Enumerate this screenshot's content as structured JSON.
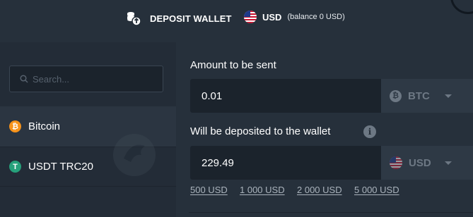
{
  "header": {
    "deposit_label": "DEPOSIT WALLET",
    "currency": "USD",
    "balance": "(balance 0 USD)"
  },
  "sidebar": {
    "search_placeholder": "Search...",
    "items": [
      {
        "label": "Bitcoin",
        "icon": "bitcoin-icon",
        "color": "#f7931a",
        "active": true
      },
      {
        "label": "USDT TRC20",
        "icon": "tether-icon",
        "color": "#26a17b",
        "active": false
      }
    ]
  },
  "form": {
    "amount_label": "Amount to be sent",
    "amount_value": "0.01",
    "amount_currency": "BTC",
    "deposit_label": "Will be deposited to the wallet",
    "deposit_value": "229.49",
    "deposit_currency": "USD",
    "quick_amounts": [
      "500 USD",
      "1 000 USD",
      "2 000 USD",
      "5 000 USD"
    ]
  },
  "colors": {
    "background": "#26303b",
    "sidebar": "#232c37",
    "input": "#1b232c",
    "muted": "#6d7884"
  }
}
